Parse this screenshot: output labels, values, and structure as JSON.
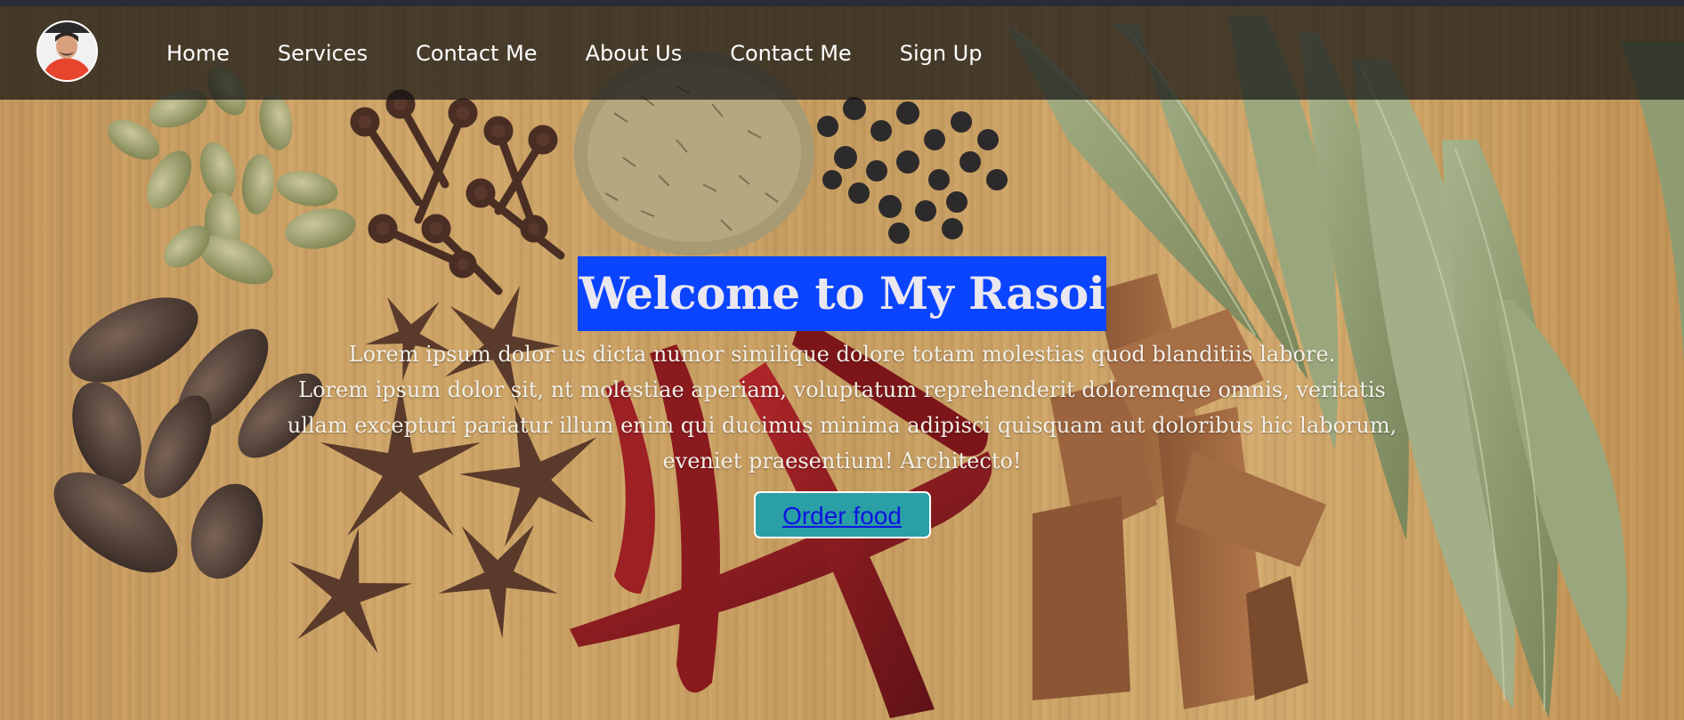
{
  "nav": {
    "avatar_alt": "profile photo",
    "items": [
      {
        "label": "Home"
      },
      {
        "label": "Services"
      },
      {
        "label": "Contact Me"
      },
      {
        "label": "About Us"
      },
      {
        "label": "Contact Me"
      },
      {
        "label": "Sign Up"
      }
    ]
  },
  "hero": {
    "title": "Welcome to My Rasoi",
    "lines": [
      "Lorem ipsum dolor us dicta numor similique dolore totam molestias quod blanditiis labore.",
      "Lorem ipsum dolor sit, nt molestiae aperiam, voluptatum reprehenderit doloremque omnis, veritatis",
      "ullam excepturi pariatur illum enim qui ducimus minima adipisci quisquam aut doloribus hic laborum,",
      "eveniet praesentium! Architecto!"
    ],
    "button_label": "Order food"
  },
  "colors": {
    "title_highlight": "#0a44ff",
    "button_bg": "#2a9fa5",
    "button_text": "#0f14e0",
    "navbar_bg": "rgba(20,20,20,0.72)"
  }
}
